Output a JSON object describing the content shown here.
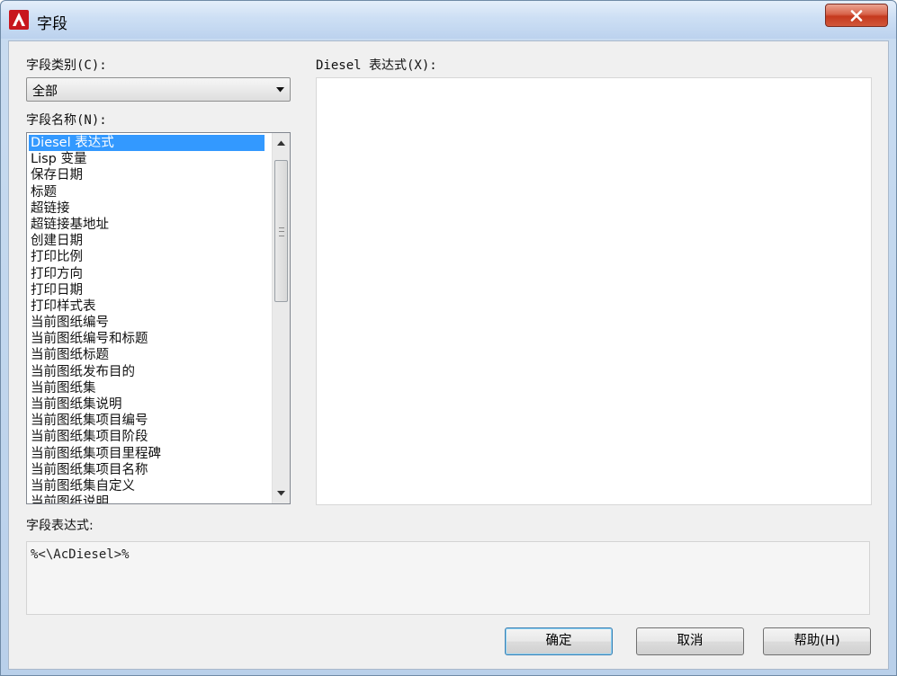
{
  "window": {
    "title": "字段",
    "close_symbol": "X"
  },
  "category": {
    "label": "字段类别(C):",
    "selected": "全部"
  },
  "names": {
    "label": "字段名称(N):",
    "items": [
      "Diesel 表达式",
      "Lisp 变量",
      "保存日期",
      "标题",
      "超链接",
      "超链接基地址",
      "创建日期",
      "打印比例",
      "打印方向",
      "打印日期",
      "打印样式表",
      "当前图纸编号",
      "当前图纸编号和标题",
      "当前图纸标题",
      "当前图纸发布目的",
      "当前图纸集",
      "当前图纸集说明",
      "当前图纸集项目编号",
      "当前图纸集项目阶段",
      "当前图纸集项目里程碑",
      "当前图纸集项目名称",
      "当前图纸集自定义",
      "当前图纸说明"
    ],
    "selected_index": 0
  },
  "diesel": {
    "label": "Diesel 表达式(X):",
    "value": ""
  },
  "expression": {
    "label": "字段表达式:",
    "value": "%<\\AcDiesel>%"
  },
  "buttons": {
    "ok": "确定",
    "cancel": "取消",
    "help": "帮助(H)"
  },
  "colors": {
    "selection": "#3399ff",
    "title_bar": "#cddff4",
    "close_button": "#c5391e",
    "dialog_bg": "#f0f0f0"
  }
}
